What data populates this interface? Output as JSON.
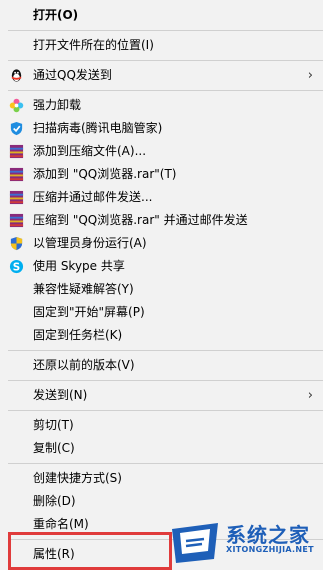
{
  "menu": {
    "open": "打开(O)",
    "open_location": "打开文件所在的位置(I)",
    "send_qq": "通过QQ发送到",
    "uninstall": "强力卸载",
    "scan": "扫描病毒(腾讯电脑管家)",
    "add_archive": "添加到压缩文件(A)...",
    "add_rar": "添加到 \"QQ浏览器.rar\"(T)",
    "compress_email": "压缩并通过邮件发送...",
    "compress_rar_email": "压缩到 \"QQ浏览器.rar\" 并通过邮件发送",
    "run_admin": "以管理员身份运行(A)",
    "skype_share": "使用 Skype 共享",
    "compat": "兼容性疑难解答(Y)",
    "pin_start": "固定到\"开始\"屏幕(P)",
    "pin_taskbar": "固定到任务栏(K)",
    "restore": "还原以前的版本(V)",
    "send_to": "发送到(N)",
    "cut": "剪切(T)",
    "copy": "复制(C)",
    "create_shortcut": "创建快捷方式(S)",
    "delete": "删除(D)",
    "rename": "重命名(M)",
    "properties": "属性(R)"
  },
  "watermark": {
    "title": "系统之家",
    "url": "XITONGZHIJIA.NET"
  },
  "colors": {
    "highlight_border": "#e03b3b",
    "watermark": "#1e5fb8"
  }
}
